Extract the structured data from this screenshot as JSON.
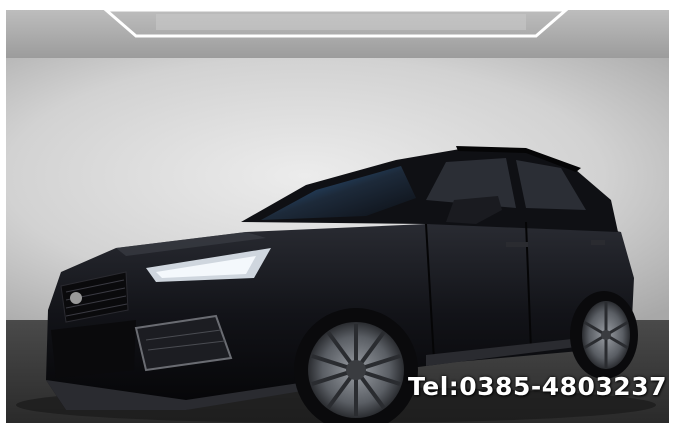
{
  "overlay": {
    "phone_text": "Tel:0385-4803237"
  },
  "colors": {
    "studio_wall": "#d6d6d6",
    "studio_floor": "#3a3a3a",
    "car_body": "#131418",
    "overlay_text": "#ffffff"
  }
}
